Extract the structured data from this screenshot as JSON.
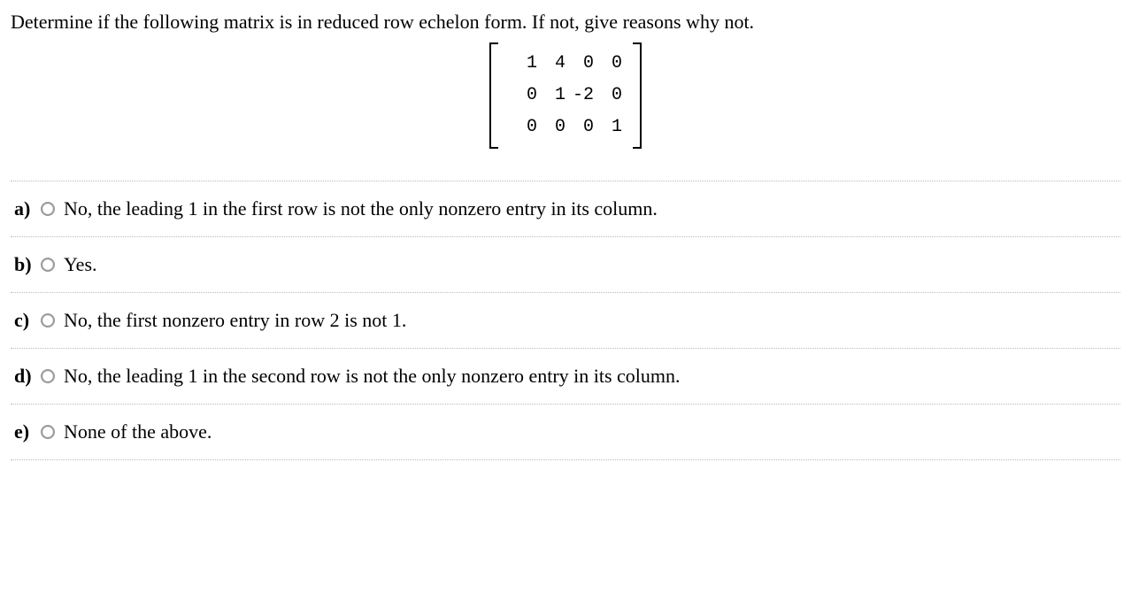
{
  "question": {
    "prompt": "Determine if the following matrix is in reduced row echelon form. If not, give reasons why not.",
    "matrix": {
      "rows": [
        [
          "1",
          "4",
          "0",
          "0"
        ],
        [
          "0",
          "1",
          "-2",
          "0"
        ],
        [
          "0",
          "0",
          "0",
          "1"
        ]
      ]
    }
  },
  "options": [
    {
      "letter": "a)",
      "text": "No, the leading 1 in the first row is not the only nonzero entry in its column."
    },
    {
      "letter": "b)",
      "text": "Yes."
    },
    {
      "letter": "c)",
      "text": "No, the first nonzero entry in row 2 is not 1."
    },
    {
      "letter": "d)",
      "text": "No, the leading 1 in the second row is not the only nonzero entry in its column."
    },
    {
      "letter": "e)",
      "text": "None of the above."
    }
  ]
}
